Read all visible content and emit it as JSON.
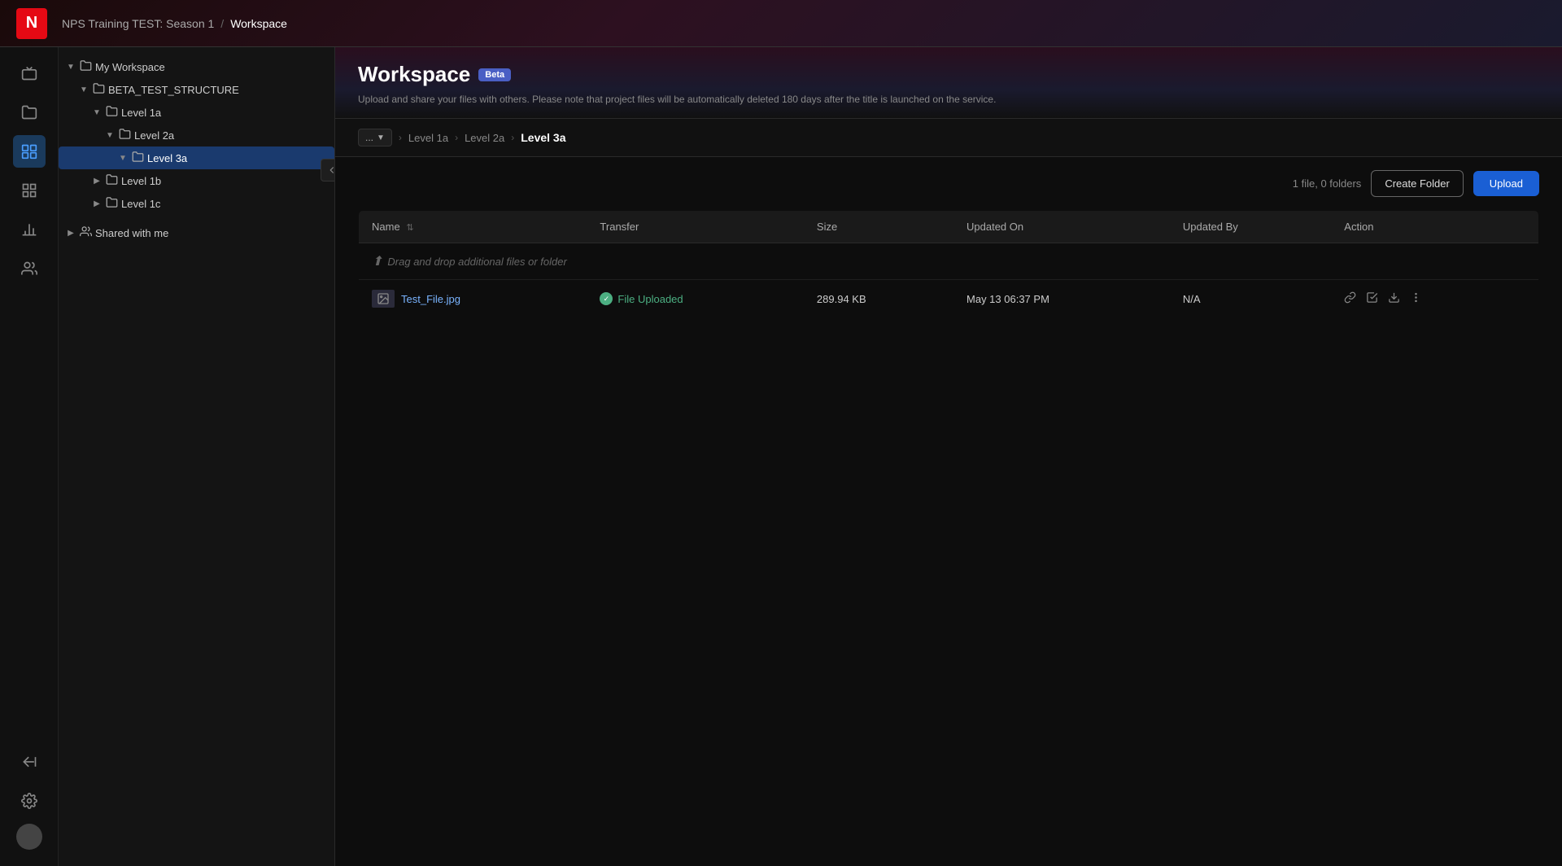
{
  "app": {
    "logo": "N",
    "logo_bg": "#e50914"
  },
  "topbar": {
    "breadcrumb_parent": "NPS Training TEST: Season 1",
    "breadcrumb_separator": "/",
    "breadcrumb_current": "Workspace"
  },
  "page": {
    "title": "Workspace",
    "badge": "Beta",
    "subtitle": "Upload and share your files with others. Please note that project files will be automatically deleted 180 days after the title is launched on the service."
  },
  "breadcrumb_nav": {
    "ellipsis": "...",
    "levels": [
      {
        "label": "Level 1a"
      },
      {
        "label": "Level 2a"
      },
      {
        "label": "Level 3a"
      }
    ]
  },
  "file_area": {
    "file_count": "1 file, 0 folders",
    "create_folder_label": "Create Folder",
    "upload_label": "Upload"
  },
  "table": {
    "columns": [
      {
        "key": "name",
        "label": "Name",
        "sort": true
      },
      {
        "key": "transfer",
        "label": "Transfer"
      },
      {
        "key": "size",
        "label": "Size"
      },
      {
        "key": "updated_on",
        "label": "Updated On"
      },
      {
        "key": "updated_by",
        "label": "Updated By"
      },
      {
        "key": "action",
        "label": "Action"
      }
    ],
    "drag_drop_text": "Drag and drop additional files or folder",
    "rows": [
      {
        "name": "Test_File.jpg",
        "transfer": "File Uploaded",
        "size": "289.94 KB",
        "updated_on": "May 13 06:37 PM",
        "updated_by": "N/A"
      }
    ]
  },
  "tree": {
    "items": [
      {
        "level": 0,
        "label": "My Workspace",
        "caret": "▼",
        "has_folder": true,
        "expanded": true
      },
      {
        "level": 1,
        "label": "BETA_TEST_STRUCTURE",
        "caret": "▼",
        "has_folder": true,
        "expanded": true
      },
      {
        "level": 2,
        "label": "Level 1a",
        "caret": "▼",
        "has_folder": true,
        "expanded": true
      },
      {
        "level": 3,
        "label": "Level 2a",
        "caret": "▼",
        "has_folder": true,
        "expanded": true
      },
      {
        "level": 4,
        "label": "Level 3a",
        "caret": "▼",
        "has_folder": true,
        "expanded": true,
        "selected": true
      },
      {
        "level": 2,
        "label": "Level 1b",
        "caret": "▶",
        "has_folder": true,
        "expanded": false
      },
      {
        "level": 2,
        "label": "Level 1c",
        "caret": "▶",
        "has_folder": true,
        "expanded": false
      }
    ],
    "shared_label": "Shared with me",
    "shared_caret": "▶"
  },
  "icons": {
    "tv": "📺",
    "folder": "📁",
    "files": "🗂",
    "grid": "▦",
    "chart": "📊",
    "users": "👥",
    "settings": "⚙",
    "avatar": "●",
    "collapse_panel": "⊢",
    "link": "🔗",
    "redirect": "↗",
    "download": "⬇",
    "more": "⋯",
    "image_thumb": "🖼"
  },
  "colors": {
    "accent": "#1a5fd4",
    "selected_bg": "#1a3a6e",
    "status_green": "#4caf82",
    "beta_badge": "#4a5fc4"
  }
}
